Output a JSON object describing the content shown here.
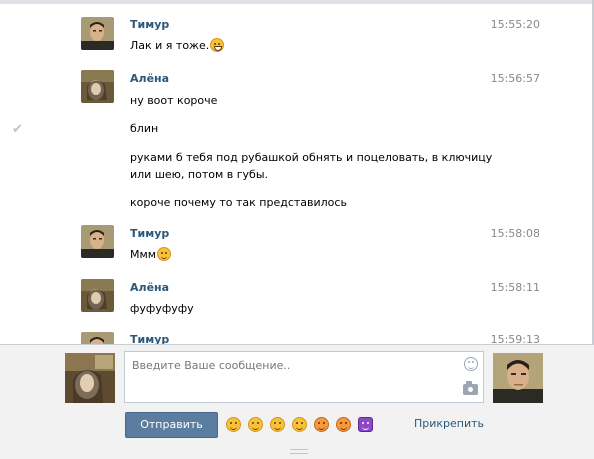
{
  "messages": [
    {
      "author": "Тимур",
      "time": "15:55:20",
      "lines": [
        "Лак и я тоже."
      ],
      "emoji": "grin",
      "avatar": "timur"
    },
    {
      "author": "Алёна",
      "time": "15:56:57",
      "lines": [
        "ну воот короче",
        "блин",
        "руками б тебя под рубашкой обнять и поцеловать, в ключицу или шею, потом в губы.",
        "короче почему то так представилось"
      ],
      "avatar": "alena"
    },
    {
      "author": "Тимур",
      "time": "15:58:08",
      "lines": [
        "Ммм"
      ],
      "emoji": "relieved",
      "avatar": "timur"
    },
    {
      "author": "Алёна",
      "time": "15:58:11",
      "lines": [
        "фуфуфуфу"
      ],
      "avatar": "alena"
    },
    {
      "author": "Тимур",
      "time": "15:59:13",
      "lines": [],
      "avatar": "timur"
    }
  ],
  "compose": {
    "placeholder": "Введите Ваше сообщение..",
    "value": "",
    "send_label": "Отправить",
    "attach_label": "Прикрепить",
    "emoji_bar": [
      "grinning-face-icon",
      "smiling-face-icon",
      "expressionless-face-icon",
      "grimacing-face-icon",
      "angry-face-icon",
      "kissing-face-icon",
      "alien-monster-icon"
    ]
  },
  "colors": {
    "author_link": "#2b587a",
    "send_button": "#5b7ea0",
    "compose_bg": "#f2f2f2"
  }
}
